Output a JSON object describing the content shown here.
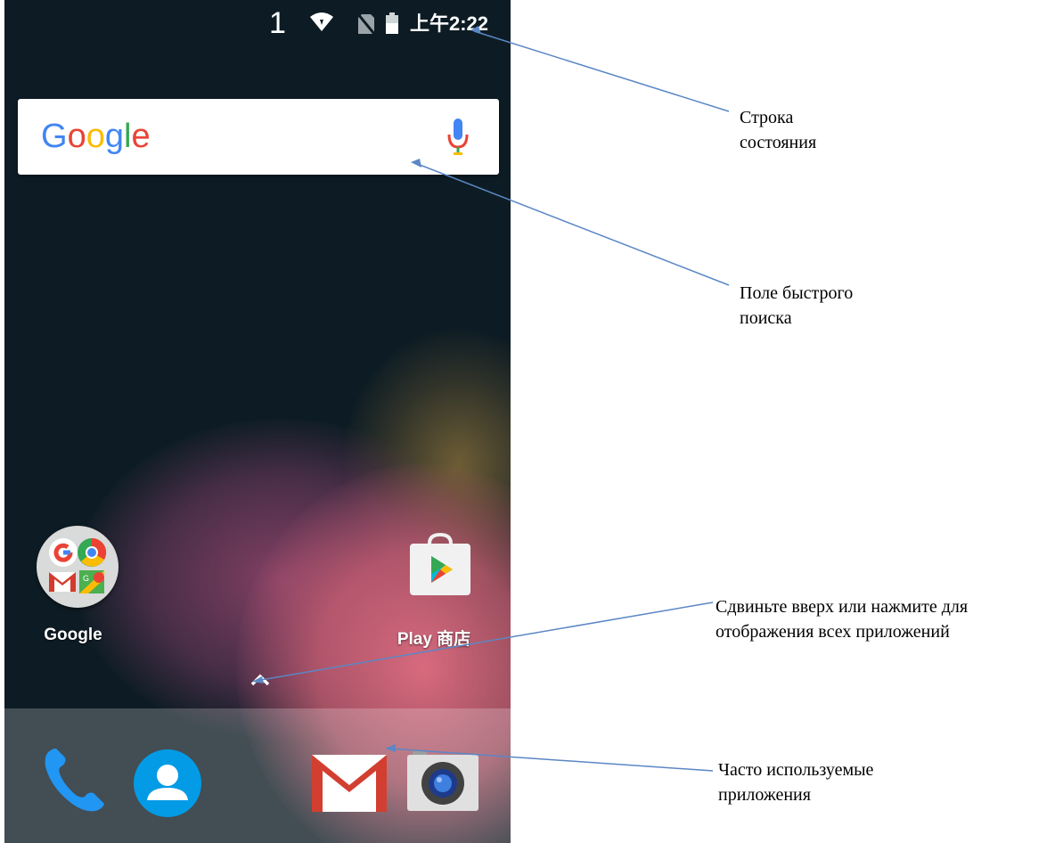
{
  "status_bar": {
    "notification_count": "1",
    "time": "上午2:22",
    "icons": [
      "wifi-icon",
      "no-sim-icon",
      "battery-icon"
    ]
  },
  "search_widget": {
    "logo_text": "Google",
    "mic_icon": "microphone-icon"
  },
  "home_apps": [
    {
      "label": "Google",
      "icon": "google-folder-icon"
    },
    {
      "label": "Play 商店",
      "icon": "play-store-icon"
    }
  ],
  "app_drawer_handle": {
    "icon": "chevron-up-icon"
  },
  "dock": {
    "apps": [
      {
        "name": "phone",
        "icon": "phone-icon"
      },
      {
        "name": "contacts",
        "icon": "contacts-icon"
      },
      {
        "name": "gmail",
        "icon": "gmail-icon"
      },
      {
        "name": "camera",
        "icon": "camera-icon"
      }
    ]
  },
  "callouts": {
    "status_bar": {
      "line1": "Строка",
      "line2": "состояния"
    },
    "search": {
      "line1": "Поле быстрого",
      "line2": "поиска"
    },
    "drawer": {
      "line1": "Сдвиньте вверх или нажмите для",
      "line2": "отображения всех приложений"
    },
    "dock": {
      "line1": "Часто используемые",
      "line2": "приложения"
    }
  },
  "colors": {
    "wallpaper_dark": "#0d1c24",
    "callout_line": "#5b87c5",
    "google_blue": "#4285f4",
    "google_red": "#ea4335",
    "google_yellow": "#fbbc05",
    "google_green": "#34a853"
  }
}
